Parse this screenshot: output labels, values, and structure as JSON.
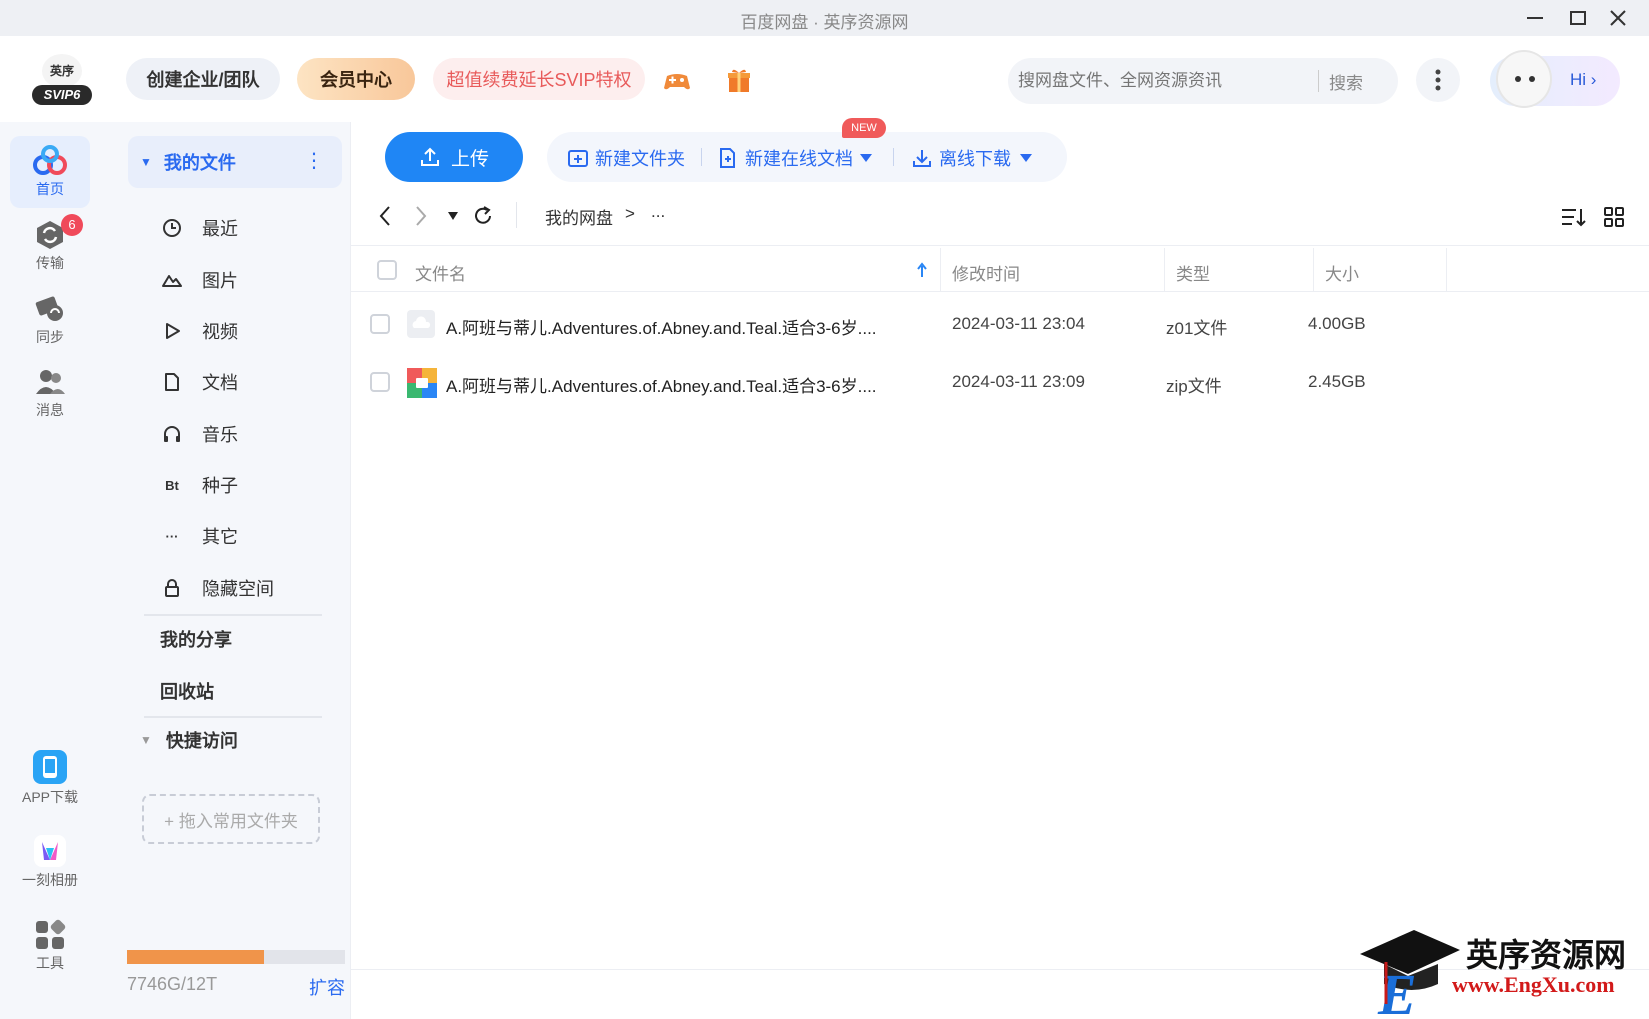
{
  "window": {
    "title": "百度网盘 · 英序资源网"
  },
  "logo": {
    "text": "英序",
    "badge": "SVIP6"
  },
  "header": {
    "team_label": "创建企业/团队",
    "vip_label": "会员中心",
    "promo_label": "超值续费延长SVIP特权",
    "search_placeholder": "搜网盘文件、全网资源资讯",
    "search_button": "搜索",
    "hi_label": "Hi ›"
  },
  "leftnav": {
    "items": [
      {
        "label": "首页",
        "icon": "cloud-home-icon"
      },
      {
        "label": "传输",
        "icon": "transfer-icon",
        "badge": "6"
      },
      {
        "label": "同步",
        "icon": "sync-icon"
      },
      {
        "label": "消息",
        "icon": "message-icon"
      }
    ],
    "bottom": [
      {
        "label": "APP下载",
        "icon": "phone-icon"
      },
      {
        "label": "一刻相册",
        "icon": "album-icon"
      },
      {
        "label": "工具",
        "icon": "tools-icon"
      }
    ]
  },
  "sidebar": {
    "my_files": "我的文件",
    "categories": [
      {
        "label": "最近",
        "icon": "clock-icon"
      },
      {
        "label": "图片",
        "icon": "image-icon"
      },
      {
        "label": "视频",
        "icon": "play-icon"
      },
      {
        "label": "文档",
        "icon": "document-icon"
      },
      {
        "label": "音乐",
        "icon": "headphones-icon"
      },
      {
        "label": "种子",
        "icon": "bt-icon",
        "glyph": "Bt"
      },
      {
        "label": "其它",
        "icon": "more-icon",
        "glyph": "···"
      },
      {
        "label": "隐藏空间",
        "icon": "lock-icon"
      }
    ],
    "my_share": "我的分享",
    "recycle": "回收站",
    "quick_access": "快捷访问",
    "drop_hint": "+ 拖入常用文件夹",
    "storage": {
      "text": "7746G/12T",
      "used_fraction": 0.6305,
      "expand": "扩容"
    }
  },
  "toolbar": {
    "upload": "上传",
    "new_folder": "新建文件夹",
    "new_doc": "新建在线文档",
    "new_badge": "NEW",
    "offline": "离线下载"
  },
  "breadcrumb": {
    "root": "我的网盘",
    "sep": ">",
    "more": "..."
  },
  "table": {
    "headers": {
      "name": "文件名",
      "modified": "修改时间",
      "type": "类型",
      "size": "大小"
    },
    "rows": [
      {
        "name": "A.阿班与蒂儿.Adventures.of.Abney.and.Teal.适合3-6岁....",
        "modified": "2024-03-11 23:04",
        "type": "z01文件",
        "size": "4.00GB",
        "icon": "file-cloud-icon"
      },
      {
        "name": "A.阿班与蒂儿.Adventures.of.Abney.and.Teal.适合3-6岁....",
        "modified": "2024-03-11 23:09",
        "type": "zip文件",
        "size": "2.45GB",
        "icon": "zip-archive-icon"
      }
    ]
  },
  "watermark": {
    "name": "英序资源网",
    "url": "www.EngXu.com"
  },
  "colors": {
    "accent": "#2a6af0",
    "upload": "#1f86f5",
    "storage_fill": "#f0944a",
    "badge": "#f04a5a"
  }
}
